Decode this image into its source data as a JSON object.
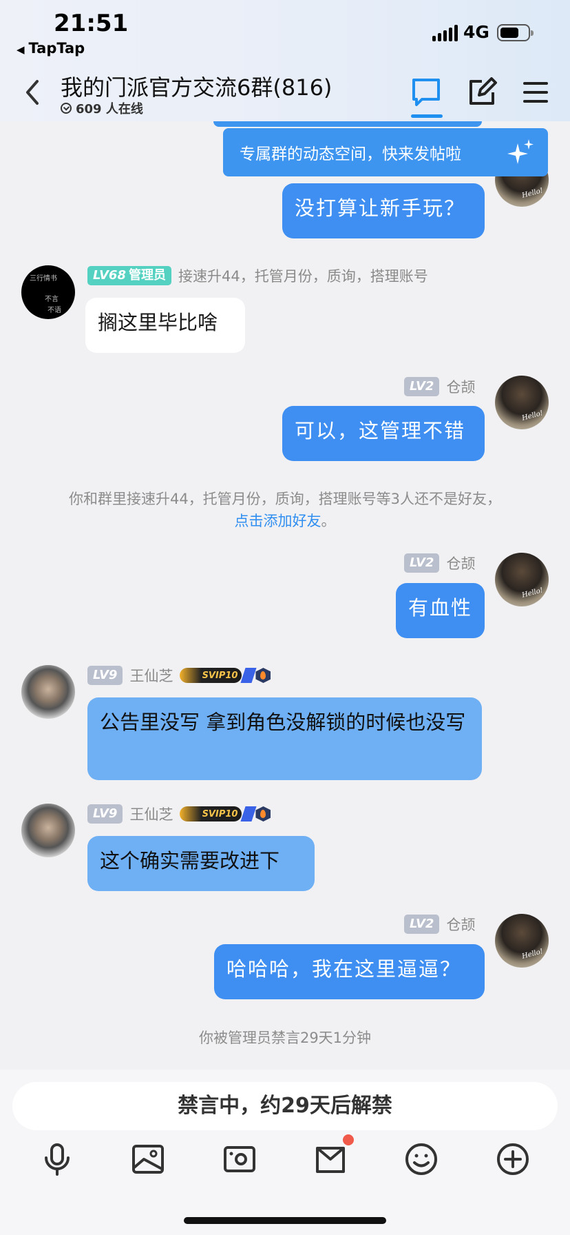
{
  "status_bar": {
    "time": "21:51",
    "back_app": "TapTap",
    "network": "4G"
  },
  "header": {
    "title": "我的门派官方交流6群(816)",
    "online": "609 人在线",
    "icons": [
      "chat-bubble-icon",
      "edit-icon",
      "menu-icon"
    ]
  },
  "banner": {
    "text": "专属群的动态空间，快来发帖啦"
  },
  "messages": [
    {
      "side": "right",
      "text": "没打算让新手玩？"
    },
    {
      "side": "left",
      "level": "LV68",
      "role": "管理员",
      "name": "接速升44，托管月份，质询，搭理账号",
      "text": "搁这里毕比啥"
    },
    {
      "side": "right",
      "level": "LV2",
      "name": "仓颉",
      "text": "可以，这管理不错"
    },
    {
      "side": "right",
      "level": "LV2",
      "name": "仓颉",
      "text": "有血性"
    },
    {
      "side": "left",
      "level": "LV9",
      "name": "王仙芝",
      "badge": "SVIP10",
      "text": "公告里没写 拿到角色没解锁的时候也没写"
    },
    {
      "side": "left",
      "level": "LV9",
      "name": "王仙芝",
      "badge": "SVIP10",
      "text": "这个确实需要改进下"
    },
    {
      "side": "right",
      "level": "LV2",
      "name": "仓颉",
      "text": "哈哈哈，我在这里逼逼？"
    }
  ],
  "notice": {
    "friends_text": "你和群里接速升44，托管月份，质询，搭理账号等3人还不是好友，",
    "friends_link": "点击添加好友",
    "friends_end": "。",
    "mute_text": "你被管理员禁言29天1分钟"
  },
  "input": {
    "muted_label": "禁言中，约29天后解禁"
  },
  "toolbar": [
    "microphone-icon",
    "image-icon",
    "camera-icon",
    "gift-icon",
    "emoji-icon",
    "plus-icon"
  ]
}
